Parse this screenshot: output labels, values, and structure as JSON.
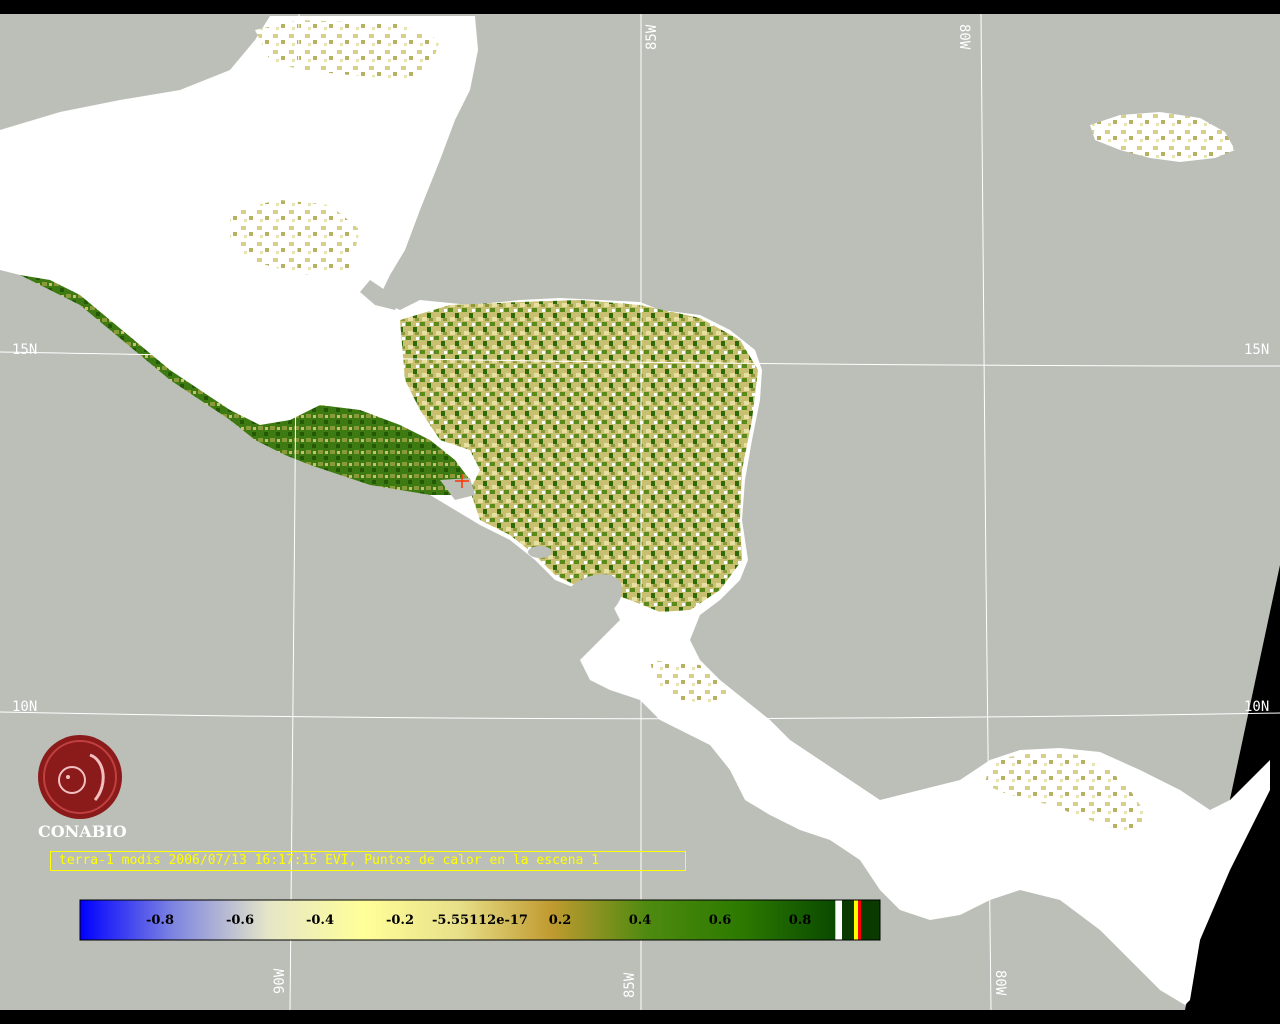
{
  "grid_labels": {
    "lat_15n_left": "15N",
    "lat_15n_right": "15N",
    "lat_10n_left": "10N",
    "lat_10n_right": "10N",
    "lon_85w_top": "85W",
    "lon_80w_top": "80W",
    "lon_90w_bottom": "90W",
    "lon_85w_bottom": "85W",
    "lon_80w_bottom": "80W"
  },
  "logo": {
    "name": "CONABIO"
  },
  "caption": "terra-1 modis 2006/07/13 16:17:15 EVI, Puntos de calor en la escena 1",
  "colorbar": {
    "ticks": [
      "-0.8",
      "-0.6",
      "-0.4",
      "-0.2",
      "-5.55112e-17",
      "0.2",
      "0.4",
      "0.6",
      "0.8"
    ],
    "stops": [
      "#0000ff",
      "#7f86e0",
      "#e6e6c8",
      "#ffff99",
      "#e8e08a",
      "#c09a30",
      "#4f8a10",
      "#2d7a00",
      "#0a4a00"
    ]
  },
  "colors": {
    "ocean": "#bcbfb8",
    "cloud": "#ffffff",
    "veg_dark": "#2f6a0a",
    "veg_mid": "#8a9a3a",
    "veg_light": "#d8d08a",
    "no_data": "#000000",
    "caption": "#ffff00"
  }
}
